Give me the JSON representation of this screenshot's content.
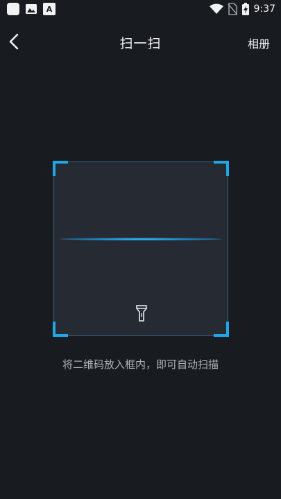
{
  "status_bar": {
    "time": "9:37",
    "left_icons": [
      "app-square-icon",
      "gallery-icon",
      "a-notification-icon"
    ],
    "a_label": "A",
    "right_icons": [
      "wifi-icon",
      "no-sim-icon",
      "battery-charging-icon"
    ]
  },
  "header": {
    "back_icon": "chevron-left-icon",
    "title": "扫一扫",
    "album_label": "相册"
  },
  "scanner": {
    "accent_color": "#1ea8ea",
    "flashlight_icon": "flashlight-icon"
  },
  "hint": "将二维码放入框内，即可自动扫描"
}
